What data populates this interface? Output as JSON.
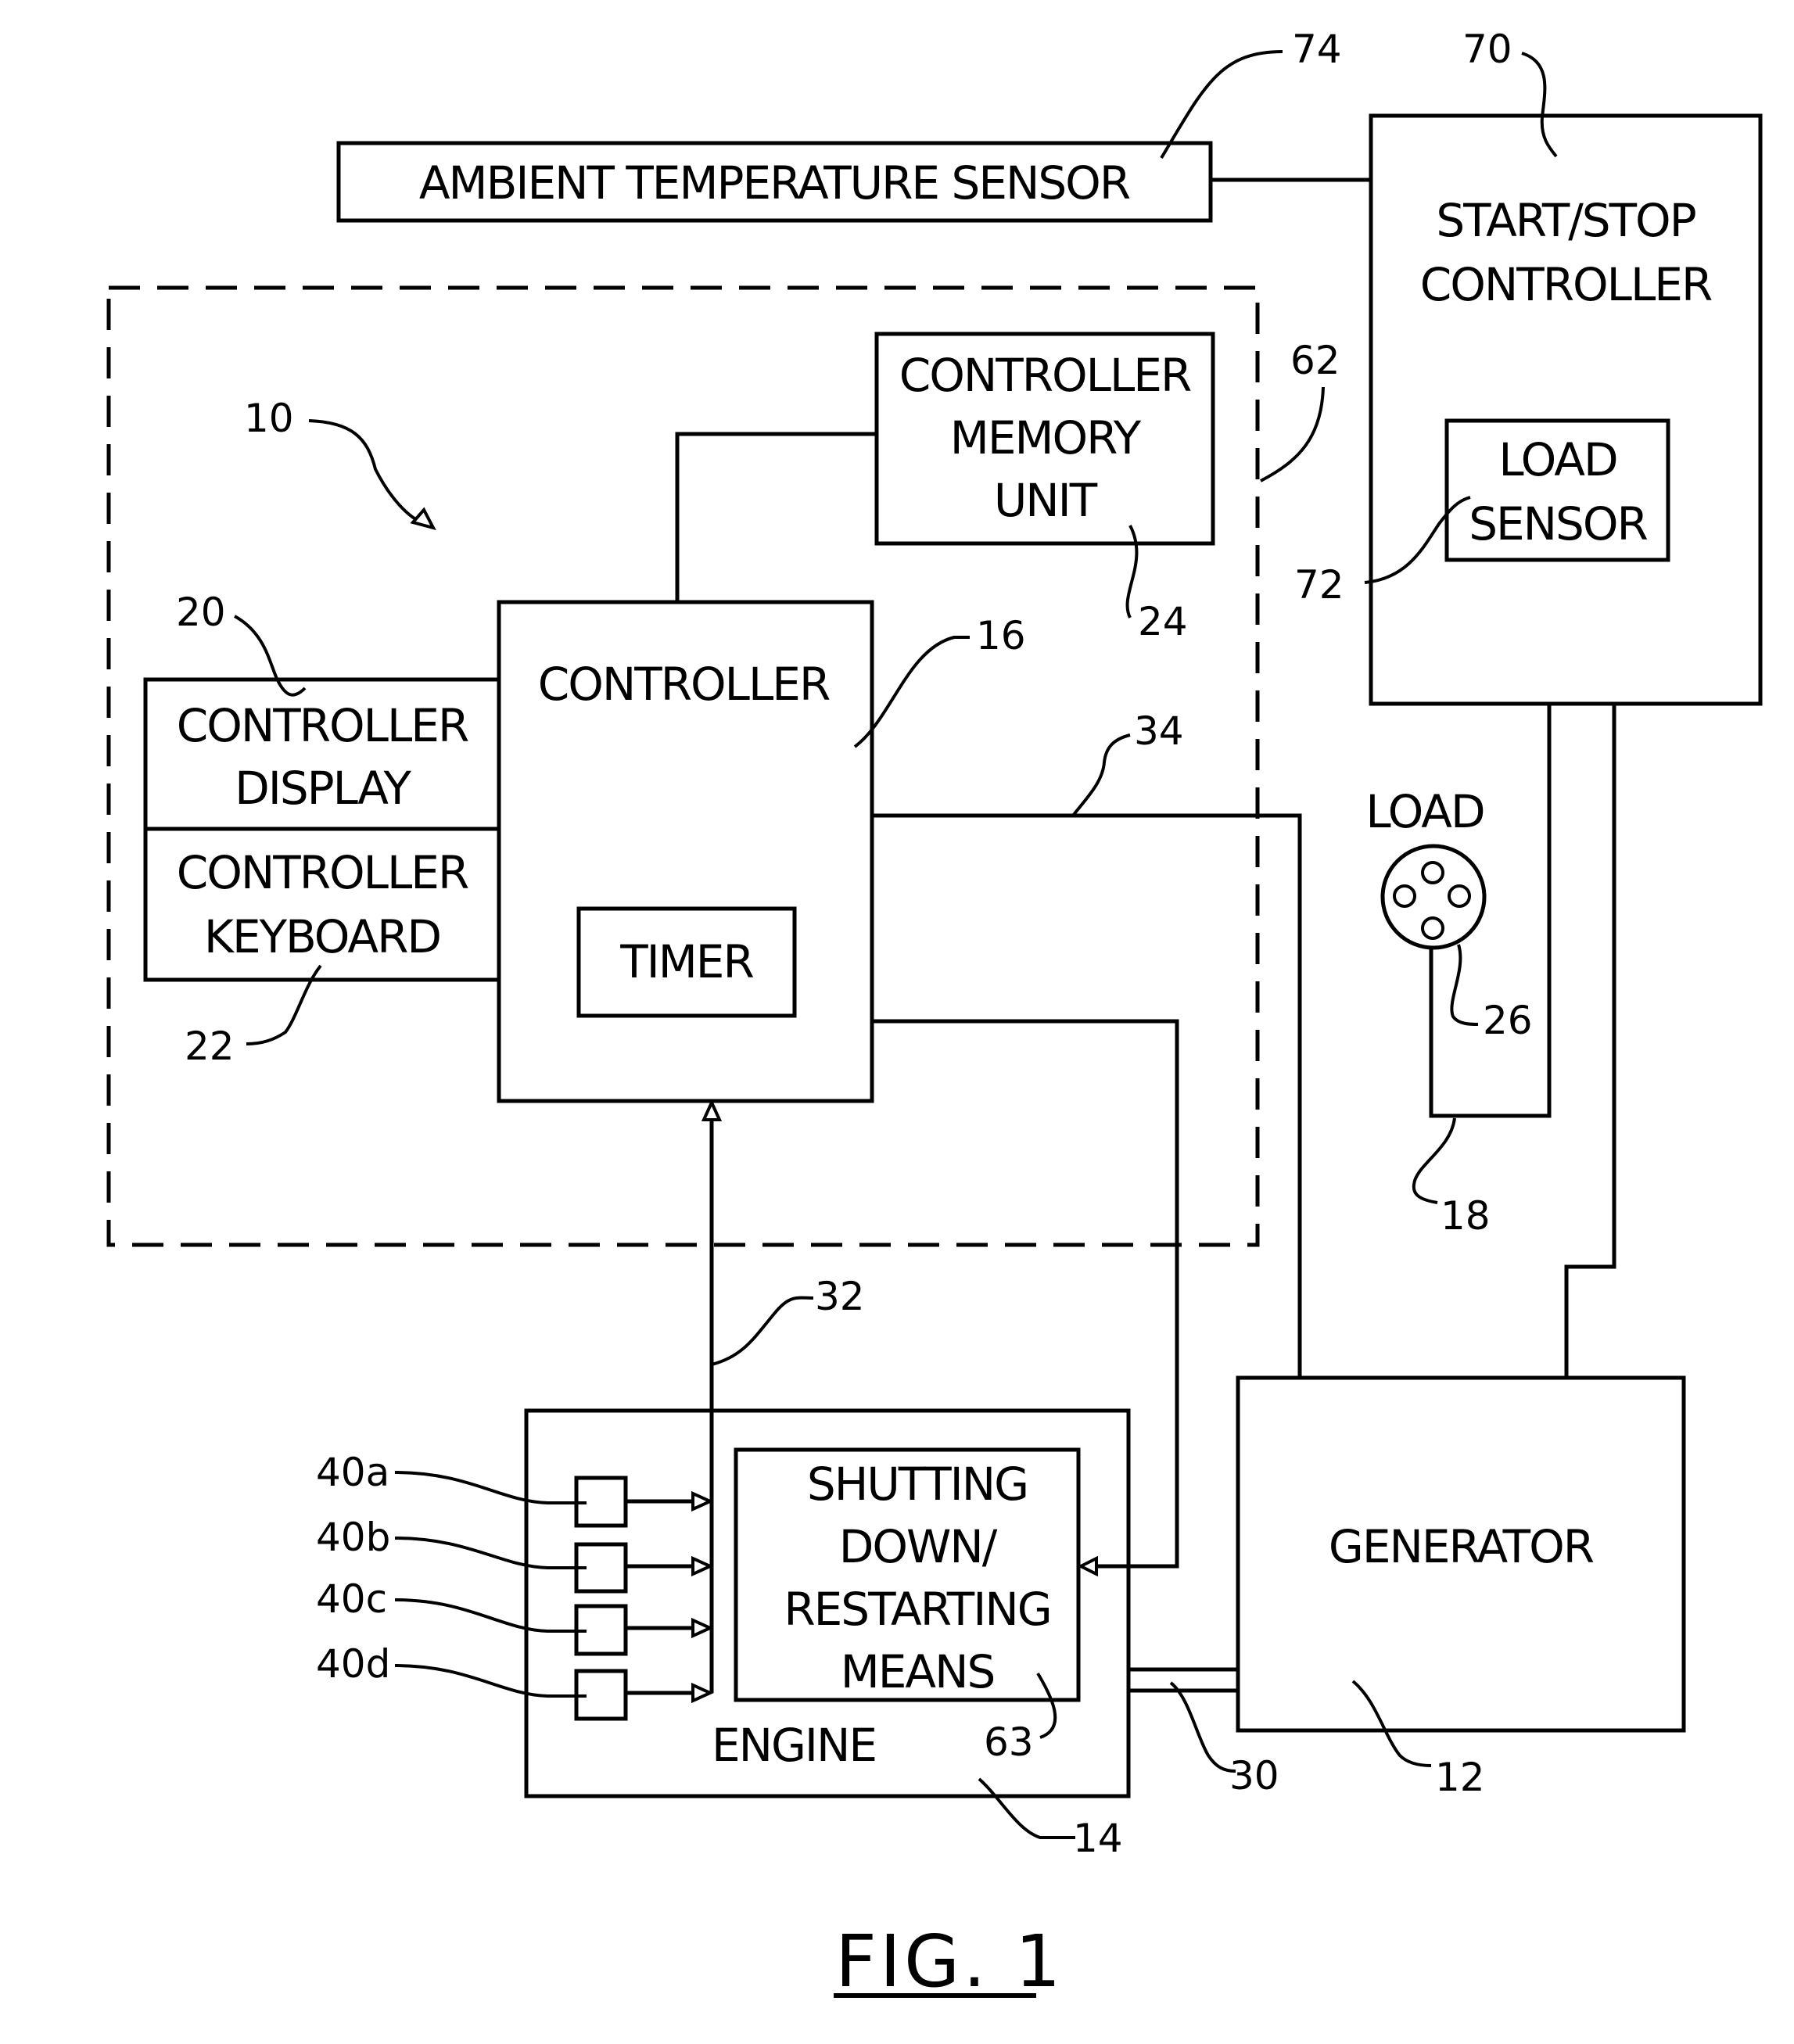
{
  "figure": {
    "caption": "FIG. 1",
    "blocks": {
      "ambient_sensor": {
        "label": "AMBIENT TEMPERATURE SENSOR",
        "ref": "74"
      },
      "start_stop": {
        "lines": [
          "START/STOP",
          "CONTROLLER"
        ],
        "ref": "70"
      },
      "load_sensor": {
        "lines": [
          "LOAD",
          "SENSOR"
        ],
        "ref": "72"
      },
      "system": {
        "ref": "10",
        "boundary_ref": "62"
      },
      "memory": {
        "lines": [
          "CONTROLLER",
          "MEMORY",
          "UNIT"
        ],
        "ref": "24"
      },
      "controller": {
        "label": "CONTROLLER",
        "ref": "16"
      },
      "timer": {
        "label": "TIMER"
      },
      "display": {
        "lines": [
          "CONTROLLER",
          "DISPLAY"
        ],
        "ref": "20"
      },
      "keyboard": {
        "lines": [
          "CONTROLLER",
          "KEYBOARD"
        ],
        "ref": "22"
      },
      "load": {
        "label": "LOAD",
        "outlet_ref": "26",
        "circuit_ref": "18"
      },
      "engine": {
        "label": "ENGINE",
        "ref": "14"
      },
      "shutdown": {
        "lines": [
          "SHUTTING",
          "DOWN/",
          "RESTARTING",
          "MEANS"
        ],
        "ref": "63"
      },
      "generator": {
        "label": "GENERATOR",
        "ref": "12"
      },
      "sensors": [
        {
          "ref": "40a"
        },
        {
          "ref": "40b"
        },
        {
          "ref": "40c"
        },
        {
          "ref": "40d"
        }
      ],
      "wires": {
        "engine_to_controller": "32",
        "controller_to_generator": "34",
        "shaft": "30"
      }
    }
  }
}
